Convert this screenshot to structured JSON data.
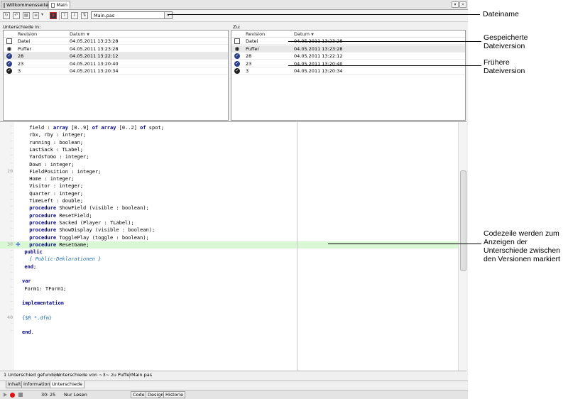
{
  "doc_tabs": [
    {
      "label": "Willkommensseite"
    },
    {
      "label": "Main"
    }
  ],
  "toolbar": {
    "file_combo_value": "Main.pas"
  },
  "left_panel": {
    "label": "Unterschiede in:",
    "columns": [
      "Revision",
      "Datum"
    ],
    "rows": [
      {
        "icon": "document-icon",
        "revision": "Datei",
        "date": "04.05.2011 13:23:28"
      },
      {
        "icon": "eye-icon",
        "revision": "Puffer",
        "date": "04.05.2011 13:23:28"
      },
      {
        "icon": "check-circle-icon",
        "revision": "28",
        "date": "04.05.2011 13:22:12"
      },
      {
        "icon": "check-circle-icon",
        "revision": "23",
        "date": "04.05.2011 13:20:40"
      },
      {
        "icon": "check-circle-dark-icon",
        "revision": "3",
        "date": "04.05.2011 13:20:34"
      }
    ],
    "selected_row": 2
  },
  "right_panel": {
    "label": "Zu:",
    "columns": [
      "Revision",
      "Datum"
    ],
    "rows": [
      {
        "icon": "document-icon",
        "revision": "Datei",
        "date": "04.05.2011 13:23:28"
      },
      {
        "icon": "eye-icon",
        "revision": "Puffer",
        "date": "04.05.2011 13:23:28"
      },
      {
        "icon": "check-circle-icon",
        "revision": "28",
        "date": "04.05.2011 13:22:12"
      },
      {
        "icon": "check-circle-icon",
        "revision": "23",
        "date": "04.05.2011 13:20:40"
      },
      {
        "icon": "check-circle-dark-icon",
        "revision": "3",
        "date": "04.05.2011 13:20:34"
      }
    ],
    "selected_row": 1
  },
  "code": {
    "lines": [
      {
        "no": "",
        "text": "field : array [0..9] of array [0..2] of spot;",
        "indent": 3
      },
      {
        "no": "",
        "text": "rbx, rby : integer;",
        "indent": 3
      },
      {
        "no": "",
        "text": "running : boolean;",
        "indent": 3
      },
      {
        "no": "",
        "text": "LastSack : TLabel;",
        "indent": 3
      },
      {
        "no": "",
        "text": "YardsToGo : integer;",
        "indent": 3
      },
      {
        "no": "",
        "text": "Down : integer;",
        "indent": 3
      },
      {
        "no": "20",
        "text": "FieldPosition : integer;",
        "indent": 3
      },
      {
        "no": "",
        "text": "Home : integer;",
        "indent": 3
      },
      {
        "no": "",
        "text": "Visitor : integer;",
        "indent": 3
      },
      {
        "no": "",
        "text": "Quarter : integer;",
        "indent": 3
      },
      {
        "no": "",
        "text": "TimeLeft : double;",
        "indent": 3
      },
      {
        "no": "",
        "text": "procedure ShowField (visible : boolean);",
        "indent": 3
      },
      {
        "no": "",
        "text": "procedure ResetField;",
        "indent": 3
      },
      {
        "no": "",
        "text": "procedure Sacked (Player : TLabel);",
        "indent": 3
      },
      {
        "no": "",
        "text": "procedure ShowDisplay (visible : boolean);",
        "indent": 3
      },
      {
        "no": "",
        "text": "procedure TogglePlay (toggle : boolean);",
        "indent": 3
      },
      {
        "no": "30",
        "text": "procedure ResetGame;",
        "indent": 3,
        "changed": true
      },
      {
        "no": "",
        "text": "public",
        "indent": 1
      },
      {
        "no": "",
        "text": "{ Public-Deklarationen }",
        "indent": 3,
        "comment": true
      },
      {
        "no": "",
        "text": "end;",
        "indent": 1
      },
      {
        "no": "",
        "text": "",
        "indent": 0
      },
      {
        "no": "",
        "text": "var",
        "indent": 0
      },
      {
        "no": "",
        "text": "Form1: TForm1;",
        "indent": 1
      },
      {
        "no": "",
        "text": "",
        "indent": 0
      },
      {
        "no": "",
        "text": "implementation",
        "indent": 0
      },
      {
        "no": "",
        "text": "",
        "indent": 0
      },
      {
        "no": "40",
        "text": "{$R *.dfm}",
        "indent": 0,
        "directive": true
      },
      {
        "no": "",
        "text": "",
        "indent": 0
      },
      {
        "no": "",
        "text": "end.",
        "indent": 0
      }
    ]
  },
  "status": {
    "found": "1 Unterschied gefunden",
    "compare": "Unterschiede von ~3~ zu Puffer",
    "file": "Main.pas"
  },
  "bottom_tabs": [
    "Inhalt",
    "Information",
    "Unterschiede"
  ],
  "bottom_tab_active": 2,
  "editor_status": {
    "line": "30",
    "col": "25",
    "mode": "Nur Lesen",
    "view_tabs": [
      "Code",
      "Design",
      "Historie"
    ]
  },
  "annotations": {
    "dateiname": "Dateiname",
    "gespeicherte_1": "Gespeicherte",
    "gespeicherte_2": "Dateiversion",
    "fruehere_1": "Frühere",
    "fruehere_2": "Dateiversion",
    "codezeile_1": "Codezeile werden zum",
    "codezeile_2": "Anzeigen der",
    "codezeile_3": "Unterschiede zwischen",
    "codezeile_4": "den Versionen markiert"
  }
}
